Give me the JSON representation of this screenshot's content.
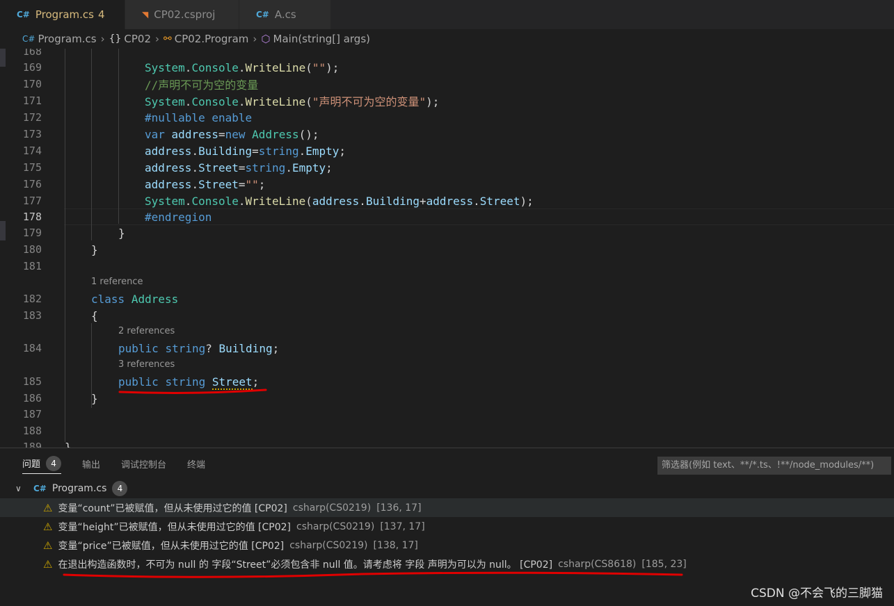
{
  "tabs": [
    {
      "label": "Program.cs",
      "count": "4",
      "icon": "C#"
    },
    {
      "label": "CP02.csproj",
      "icon": "rss-icon"
    },
    {
      "label": "A.cs",
      "icon": "C#"
    }
  ],
  "breadcrumb": {
    "file": "Program.cs",
    "ns": "CP02",
    "cls": "CP02.Program",
    "method": "Main(string[] args)"
  },
  "editor": {
    "lines": {
      "l168": "168",
      "l169": "169",
      "l170": "170",
      "l171": "171",
      "l172": "172",
      "l173": "173",
      "l174": "174",
      "l175": "175",
      "l176": "176",
      "l177": "177",
      "l178": "178",
      "l179": "179",
      "l180": "180",
      "l181": "181",
      "l182": "182",
      "l183": "183",
      "l184": "184",
      "l185": "185",
      "l186": "186",
      "l187": "187",
      "l188": "188",
      "l189": "189"
    },
    "refs": {
      "r182": "1 reference",
      "r184": "2 references",
      "r185": "3 references"
    },
    "tokens": {
      "system": "System",
      "dot": ".",
      "console": "Console",
      "writeline": "WriteLine",
      "lparen": "(",
      "rparen": ")",
      "semi": ";",
      "emptystr": "\"\"",
      "comment": "//声明不可为空的变量",
      "str171": "\"声明不可为空的变量\"",
      "nullable": "#nullable enable",
      "var": "var",
      "address": "address",
      "eq": "=",
      "new": "new",
      "Address": "Address",
      "parens": "()",
      "Building": "Building",
      "Street": "Street",
      "string": "string",
      "Empty": "Empty",
      "plus": "+",
      "endregion": "#endregion",
      "rbrace": "}",
      "lbrace": "{",
      "class": "class",
      "public": "public",
      "qmark": "?"
    }
  },
  "panel": {
    "tabs": {
      "problems": "问题",
      "problems_count": "4",
      "output": "输出",
      "debug": "调试控制台",
      "terminal": "终端"
    },
    "filter_placeholder": "筛选器(例如 text、**/*.ts、!**/node_modules/**)",
    "file": {
      "name": "Program.cs",
      "count": "4"
    },
    "problems": [
      {
        "msg": "变量“count”已被赋值，但从未使用过它的值 [CP02]",
        "src": "csharp(CS0219)",
        "pos": "[136, 17]"
      },
      {
        "msg": "变量“height”已被赋值，但从未使用过它的值 [CP02]",
        "src": "csharp(CS0219)",
        "pos": "[137, 17]"
      },
      {
        "msg": "变量“price”已被赋值，但从未使用过它的值 [CP02]",
        "src": "csharp(CS0219)",
        "pos": "[138, 17]"
      },
      {
        "msg": "在退出构造函数时，不可为 null 的 字段“Street”必须包含非 null 值。请考虑将 字段 声明为可以为 null。 [CP02]",
        "src": "csharp(CS8618)",
        "pos": "[185, 23]"
      }
    ]
  },
  "watermark": "CSDN @不会飞的三脚猫",
  "colors": {
    "keyword": "#569cd6",
    "type": "#4ec9b0",
    "method": "#dcdcaa",
    "string": "#ce9178",
    "comment": "#6a9955",
    "variable": "#9cdcfe",
    "warning": "#cca700",
    "annotation": "#e00000"
  }
}
